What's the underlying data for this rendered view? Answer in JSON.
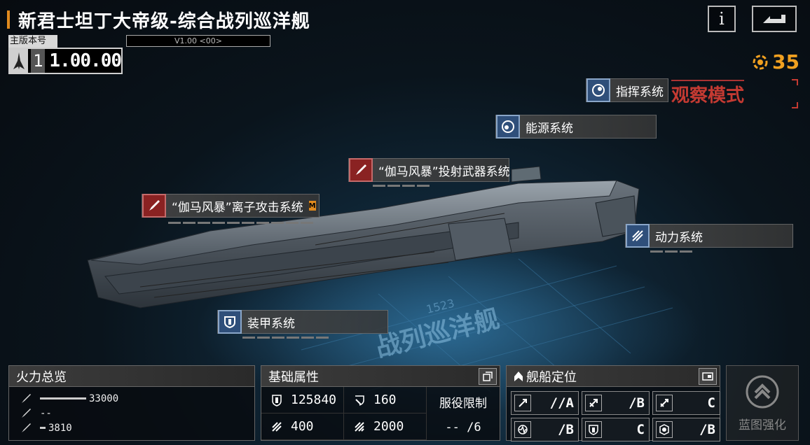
{
  "header": {
    "title": "新君士坦丁大帝级-综合战列巡洋舰",
    "info_label": "i",
    "version_label": "主版本号",
    "version_code": "V1.00 <00>",
    "version_major": "1",
    "version_minor": "1.00.00",
    "points": "35"
  },
  "viewport": {
    "observe_mode": "观察模式",
    "watermark_number": "1523",
    "watermark_text": "战列巡洋舰"
  },
  "systems": {
    "command": "指挥系统",
    "energy": "能源系统",
    "projectile": "“伽马风暴”投射武器系统",
    "ion": "“伽马风暴”离子攻击系统",
    "ion_badge": "M",
    "power": "动力系统",
    "armor": "装甲系统"
  },
  "firepower": {
    "title": "火力总览",
    "rows": [
      {
        "icon": "missile-icon",
        "value": "33000",
        "fill": 1.0
      },
      {
        "icon": "missile-icon",
        "value": "--",
        "fill": 0
      },
      {
        "icon": "missile-icon",
        "value": "3810",
        "fill": 0.12
      }
    ]
  },
  "attributes": {
    "title": "基础属性",
    "hp": "125840",
    "defense": "160",
    "speed": "400",
    "warp": "2000",
    "service_label": "服役限制",
    "service_value": "-- /6"
  },
  "positioning": {
    "title": "舰船定位",
    "cells": [
      {
        "icon": "attack-icon",
        "value": "//A"
      },
      {
        "icon": "strike-icon",
        "value": "/B"
      },
      {
        "icon": "range-icon",
        "value": "C"
      },
      {
        "icon": "sensor-icon",
        "value": "/B"
      },
      {
        "icon": "shield-icon",
        "value": "C"
      },
      {
        "icon": "support-icon",
        "value": "/B"
      }
    ]
  },
  "blueprint": {
    "label": "蓝图强化"
  },
  "colors": {
    "accent": "#e08a1e",
    "observe": "#c43a32",
    "system_blue": "#2f4f7a",
    "system_red": "#8a2222"
  }
}
